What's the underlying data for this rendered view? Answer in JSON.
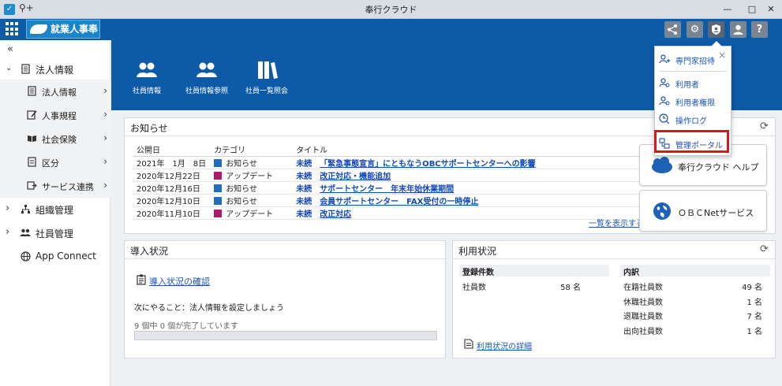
{
  "window": {
    "title": "奉行クラウド",
    "minimize": "—",
    "maximize": "□",
    "close": "✕"
  },
  "appbar": {
    "logo": "就業人事奉行",
    "icons": [
      "share-icon",
      "gear-icon",
      "shield-user-icon",
      "user-icon",
      "help-icon"
    ],
    "help_label": "?"
  },
  "sidebar": {
    "collapse": "«",
    "items": [
      {
        "label": "法人情報",
        "icon": "building-icon",
        "chevron": "⌄"
      },
      {
        "label": "法人情報",
        "icon": "building-icon"
      },
      {
        "label": "人事規程",
        "icon": "edit-doc-icon"
      },
      {
        "label": "社会保険",
        "icon": "book-icon"
      },
      {
        "label": "区分",
        "icon": "doc-icon"
      },
      {
        "label": "サービス連携",
        "icon": "link-icon"
      },
      {
        "label": "組織管理",
        "icon": "org-icon",
        "chevron": "›"
      },
      {
        "label": "社員管理",
        "icon": "people-icon",
        "chevron": "›"
      },
      {
        "label": "App Connect",
        "icon": "globe-icon"
      }
    ]
  },
  "banner": {
    "items": [
      {
        "label": "社員情報"
      },
      {
        "label": "社員情報参照"
      },
      {
        "label": "社員一覧照会"
      }
    ]
  },
  "news": {
    "title": "お知らせ",
    "headers": [
      "公開日",
      "カテゴリ",
      "タイトル"
    ],
    "rows": [
      {
        "date": "2021年　1月　8日",
        "category": "お知らせ",
        "color": "#1f6fbf",
        "status": "未読",
        "title": "「緊急事態宣言」にともなうOBCサポートセンターへの影響"
      },
      {
        "date": "2020年12月22日",
        "category": "アップデート",
        "color": "#b0186b",
        "status": "未読",
        "title": "改正対応・機能追加"
      },
      {
        "date": "2020年12月16日",
        "category": "お知らせ",
        "color": "#1f6fbf",
        "status": "未読",
        "title": "サポートセンター　年末年始休業期間"
      },
      {
        "date": "2020年12月10日",
        "category": "お知らせ",
        "color": "#1f6fbf",
        "status": "未読",
        "title": "会員サポートセンター　FAX受付の一時停止"
      },
      {
        "date": "2020年11月10日",
        "category": "アップデート",
        "color": "#b0186b",
        "status": "未読",
        "title": "改正対応"
      }
    ],
    "more": "一覧を表示する"
  },
  "help_buttons": [
    {
      "label": "奉行クラウド ヘルプ"
    },
    {
      "label": "ＯＢＣNetサービス"
    }
  ],
  "intro": {
    "title": "導入状況",
    "link": "導入状況の確認",
    "next": "次にやること：法人情報を設定しましょう",
    "progress": "9 個中 0 個が完了しています",
    "progress_value": 0
  },
  "usage": {
    "title": "利用状況",
    "registered": {
      "title": "登録件数",
      "rows": [
        {
          "label": "社員数",
          "value": "58 名"
        }
      ]
    },
    "breakdown": {
      "title": "内訳",
      "rows": [
        {
          "label": "在籍社員数",
          "value": "49 名"
        },
        {
          "label": "休職社員数",
          "value": "1 名"
        },
        {
          "label": "退職社員数",
          "value": "7 名"
        },
        {
          "label": "出向社員数",
          "value": "1 名"
        }
      ]
    },
    "detail_link": "利用状況の詳細"
  },
  "dropdown": {
    "close": "×",
    "items": [
      {
        "label": "専門家招待"
      },
      {
        "label": "利用者"
      },
      {
        "label": "利用者権限"
      },
      {
        "label": "操作ログ"
      },
      {
        "label": "管理ポータル"
      }
    ]
  }
}
